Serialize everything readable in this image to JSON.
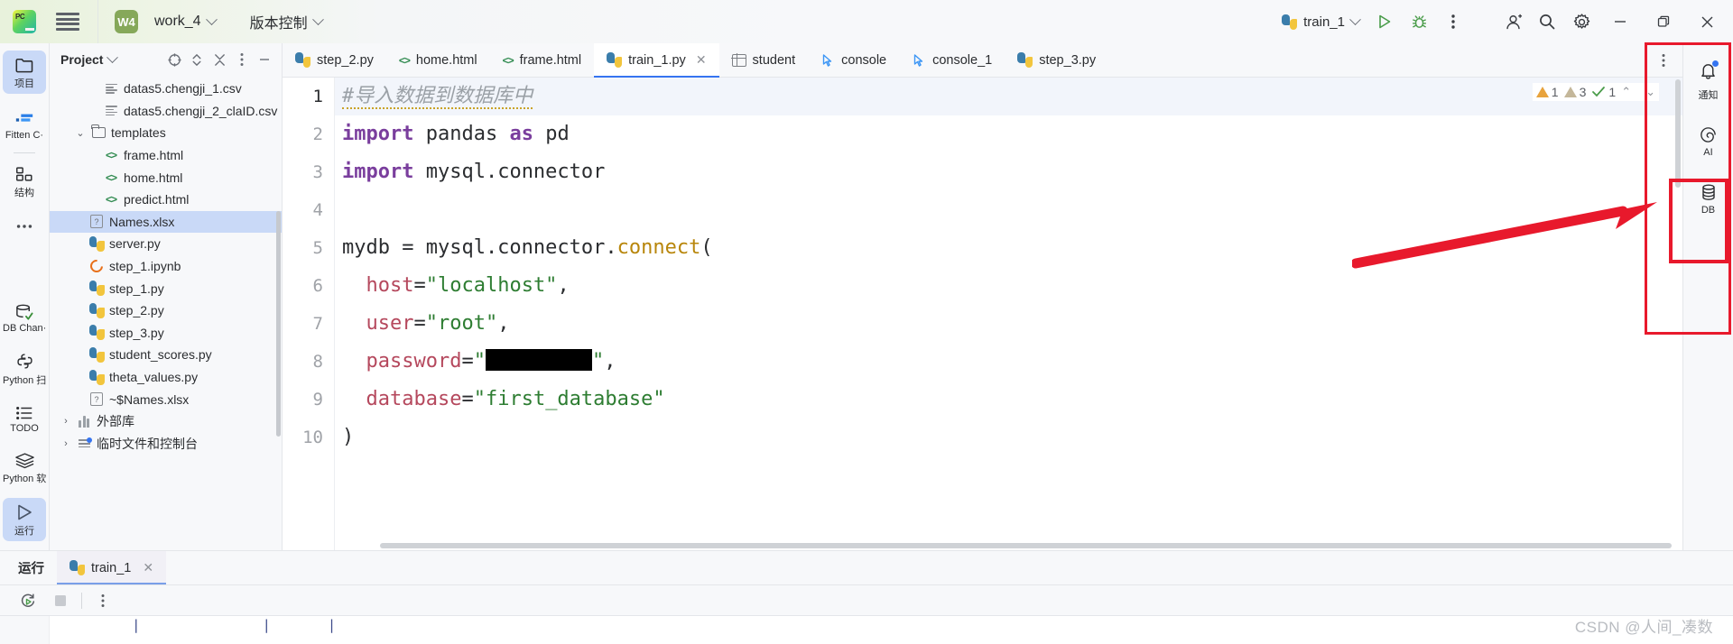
{
  "titlebar": {
    "logo_icon": "pycharm-logo-icon",
    "menu_icon": "hamburger-menu-icon",
    "project_badge": "W4",
    "project_name": "work_4",
    "vcs_label": "版本控制",
    "run_config_name": "train_1",
    "run_icon": "run-triangle-icon",
    "debug_icon": "debug-bug-icon",
    "more_icon": "more-vertical-icon",
    "account_icon": "user-account-icon",
    "search_icon": "search-icon",
    "settings_icon": "gear-icon",
    "minimize_icon": "minimize-icon",
    "maximize_icon": "maximize-icon",
    "close_icon": "close-icon"
  },
  "leftbar": {
    "items": [
      {
        "label": "项目",
        "icon": "folder-icon",
        "active": true
      },
      {
        "label": "Fitten C·",
        "icon": "fitten-code-icon",
        "active": false
      },
      {
        "label": "结构",
        "icon": "structure-icon",
        "active": false
      },
      {
        "label": "...",
        "icon": "more-dots-icon",
        "active": false
      },
      {
        "label": "DB Chan·",
        "icon": "db-changes-icon",
        "active": false
      },
      {
        "label": "Python 扫",
        "icon": "python-packages-icon",
        "active": false
      },
      {
        "label": "TODO",
        "icon": "todo-list-icon",
        "active": false
      },
      {
        "label": "Python 软",
        "icon": "python-layers-icon",
        "active": false
      },
      {
        "label": "运行",
        "icon": "run-triangle-icon",
        "active": true
      }
    ]
  },
  "project_panel": {
    "title": "Project",
    "title_chevron": "chevron-down-icon",
    "actions": [
      {
        "name": "select-opened-file-icon"
      },
      {
        "name": "expand-collapse-icon"
      },
      {
        "name": "collapse-all-icon"
      },
      {
        "name": "options-icon"
      },
      {
        "name": "hide-icon"
      }
    ],
    "tree": [
      {
        "label": "datas5.chengji_1.csv",
        "indent": 3,
        "icon": "csv-file-icon",
        "arrow": "",
        "selected": false
      },
      {
        "label": "datas5.chengji_2_claID.csv",
        "indent": 3,
        "icon": "csv-file-icon",
        "arrow": "",
        "selected": false
      },
      {
        "label": "templates",
        "indent": 2,
        "icon": "folder-icon",
        "arrow": "v",
        "selected": false
      },
      {
        "label": "frame.html",
        "indent": 3,
        "icon": "html-file-icon",
        "arrow": "",
        "selected": false
      },
      {
        "label": "home.html",
        "indent": 3,
        "icon": "html-file-icon",
        "arrow": "",
        "selected": false
      },
      {
        "label": "predict.html",
        "indent": 3,
        "icon": "html-file-icon",
        "arrow": "",
        "selected": false
      },
      {
        "label": "Names.xlsx",
        "indent": 2,
        "icon": "xlsx-file-icon",
        "arrow": "",
        "selected": true
      },
      {
        "label": "server.py",
        "indent": 2,
        "icon": "python-file-icon",
        "arrow": "",
        "selected": false
      },
      {
        "label": "step_1.ipynb",
        "indent": 2,
        "icon": "ipynb-file-icon",
        "arrow": "",
        "selected": false
      },
      {
        "label": "step_1.py",
        "indent": 2,
        "icon": "python-file-icon",
        "arrow": "",
        "selected": false
      },
      {
        "label": "step_2.py",
        "indent": 2,
        "icon": "python-file-icon",
        "arrow": "",
        "selected": false
      },
      {
        "label": "step_3.py",
        "indent": 2,
        "icon": "python-file-icon",
        "arrow": "",
        "selected": false
      },
      {
        "label": "student_scores.py",
        "indent": 2,
        "icon": "python-file-icon",
        "arrow": "",
        "selected": false
      },
      {
        "label": "theta_values.py",
        "indent": 2,
        "icon": "python-file-icon",
        "arrow": "",
        "selected": false
      },
      {
        "label": "~$Names.xlsx",
        "indent": 2,
        "icon": "xlsx-file-icon",
        "arrow": "",
        "selected": false
      },
      {
        "label": "外部库",
        "indent": 1,
        "icon": "library-icon",
        "arrow": ">",
        "selected": false
      },
      {
        "label": "临时文件和控制台",
        "indent": 1,
        "icon": "scratches-icon",
        "arrow": ">",
        "selected": false
      }
    ]
  },
  "editor_tabs": [
    {
      "label": "step_2.py",
      "icon": "python-file-icon",
      "active": false,
      "closable": false
    },
    {
      "label": "home.html",
      "icon": "html-file-icon",
      "active": false,
      "closable": false
    },
    {
      "label": "frame.html",
      "icon": "html-file-icon",
      "active": false,
      "closable": false
    },
    {
      "label": "train_1.py",
      "icon": "python-file-icon",
      "active": true,
      "closable": true
    },
    {
      "label": "student",
      "icon": "table-icon",
      "active": false,
      "closable": false
    },
    {
      "label": "console",
      "icon": "console-query-icon",
      "active": false,
      "closable": false
    },
    {
      "label": "console_1",
      "icon": "console-query-icon",
      "active": false,
      "closable": false
    },
    {
      "label": "step_3.py",
      "icon": "python-file-icon",
      "active": false,
      "closable": false
    }
  ],
  "editor": {
    "more_icon": "more-vertical-icon",
    "inspection": {
      "error_count": "1",
      "warning_count": "3",
      "ok_count": "1",
      "up_icon": "chevron-up-icon",
      "down_icon": "chevron-down-icon"
    },
    "lines": [
      {
        "n": "1",
        "current": true
      },
      {
        "n": "2",
        "current": false
      },
      {
        "n": "3",
        "current": false
      },
      {
        "n": "4",
        "current": false
      },
      {
        "n": "5",
        "current": false
      },
      {
        "n": "6",
        "current": false
      },
      {
        "n": "7",
        "current": false
      },
      {
        "n": "8",
        "current": false
      },
      {
        "n": "9",
        "current": false
      },
      {
        "n": "10",
        "current": false
      }
    ],
    "code": {
      "l1_comment": "#导入数据到数据库中",
      "l2_kw": "import",
      "l2_mod": " pandas ",
      "l2_as": "as",
      "l2_alias": " pd",
      "l3_kw": "import",
      "l3_mod": " mysql.connector",
      "l5_var": "mydb = mysql.connector.",
      "l5_fn": "connect",
      "l5_paren": "(",
      "l6_param": "host",
      "l6_eq": "=",
      "l6_val": "\"localhost\"",
      "l6_comma": ",",
      "l7_param": "user",
      "l7_eq": "=",
      "l7_val": "\"root\"",
      "l7_comma": ",",
      "l8_param": "password",
      "l8_eq": "=",
      "l8_quote_open": "\"",
      "l8_quote_close": "\"",
      "l8_comma": ",",
      "l9_param": "database",
      "l9_eq": "=",
      "l9_val": "\"first_database\"",
      "l10_close": ")"
    }
  },
  "rightbar": {
    "more_icon": "more-vertical-icon",
    "items": [
      {
        "label": "通知",
        "icon": "notifications-bell-icon",
        "badge": true
      },
      {
        "label": "AI",
        "icon": "ai-assistant-icon",
        "badge": false
      },
      {
        "label": "DB",
        "icon": "database-icon",
        "badge": false
      }
    ]
  },
  "run_panel": {
    "title": "运行",
    "tab_label": "train_1",
    "tab_icon": "python-file-icon",
    "tab_close_icon": "close-icon",
    "rerun_icon": "rerun-icon",
    "stop_icon": "stop-square-icon",
    "more_icon": "more-vertical-icon"
  },
  "watermark": "CSDN @人间_凑数",
  "annotations": {
    "box_color": "#e8192c",
    "arrow_color": "#e8192c",
    "target": "DB"
  }
}
